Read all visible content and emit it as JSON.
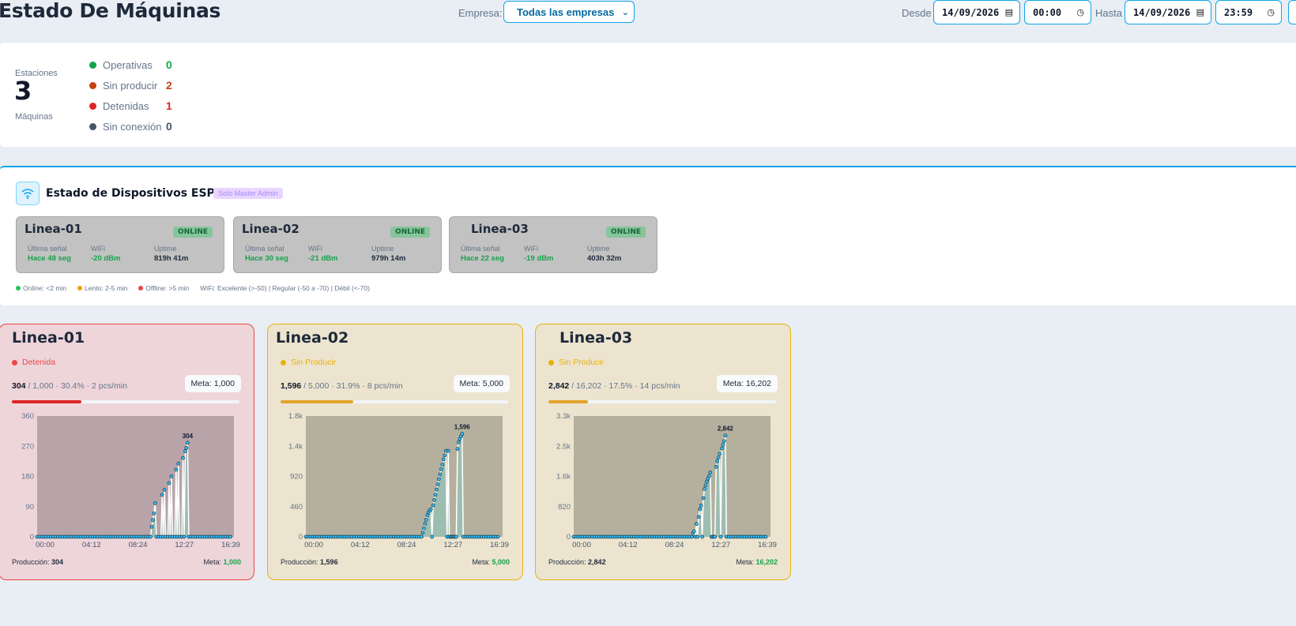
{
  "header": {
    "title": "Estado De Máquinas",
    "empresa_label": "Empresa:",
    "empresa_value": "Todas las empresas",
    "desde_label": "Desde",
    "desde_date": "14/09/2026",
    "desde_time": "00:00",
    "hasta_label": "Hasta",
    "hasta_date": "14/09/2026",
    "hasta_time": "23:59"
  },
  "summary": {
    "top_label": "Estaciones",
    "count": "3",
    "bottom_label": "Máquinas",
    "statuses": [
      {
        "label": "Operativas",
        "value": "0",
        "color": "#16a34a"
      },
      {
        "label": "Sin producir",
        "value": "2",
        "color": "#c2410c"
      },
      {
        "label": "Detenidas",
        "value": "1",
        "color": "#dc2626"
      },
      {
        "label": "Sin conexión",
        "value": "0",
        "color": "#475569"
      }
    ]
  },
  "devices": {
    "title": "Estado de Dispositivos ESP32",
    "badge": "Solo Master Admin",
    "metric_labels": {
      "signal": "Última señal",
      "wifi": "WiFi",
      "uptime": "Uptime"
    },
    "items": [
      {
        "name": "Linea-01",
        "status": "ONLINE",
        "signal": "Hace 48 seg",
        "wifi": "-20 dBm",
        "uptime": "819h 41m"
      },
      {
        "name": "Linea-02",
        "status": "ONLINE",
        "signal": "Hace 30 seg",
        "wifi": "-21 dBm",
        "uptime": "979h 14m"
      },
      {
        "name": "Linea-03",
        "status": "ONLINE",
        "signal": "Hace 22 seg",
        "wifi": "-19 dBm",
        "uptime": "403h 32m"
      }
    ],
    "legend": {
      "online": "Online: <2 min",
      "slow": "Lento: 2-5 min",
      "offline": "Offline: >5 min",
      "wifi": "WiFi: Excelente (>-50) | Regular (-50 a -70) | Débil (<-70)"
    },
    "colors": {
      "online": "#22c55e",
      "slow": "#f59e0b",
      "offline": "#ef4444",
      "ok_text": "#16a34a"
    }
  },
  "machines": [
    {
      "name": "Linea-01",
      "status": "Detenida",
      "status_color": "#ef4444",
      "produced": "304",
      "goal_text": "1,000",
      "pct": "30.4%",
      "rate": "2 pcs/min",
      "meta_label": "Meta: 1,000",
      "progress": 0.304,
      "bar_color": "#dc2626",
      "footer_prod_label": "Producción:",
      "footer_prod": "304",
      "footer_meta_label": "Meta:",
      "footer_meta": "1,000"
    },
    {
      "name": "Linea-02",
      "status": "Sin Producir",
      "status_color": "#eab308",
      "produced": "1,596",
      "goal_text": "5,000",
      "pct": "31.9%",
      "rate": "8 pcs/min",
      "meta_label": "Meta: 5,000",
      "progress": 0.319,
      "bar_color": "#e2a42c",
      "footer_prod_label": "Producción:",
      "footer_prod": "1,596",
      "footer_meta_label": "Meta:",
      "footer_meta": "5,000"
    },
    {
      "name": "Linea-03",
      "status": "Sin Producir",
      "status_color": "#eab308",
      "produced": "2,842",
      "goal_text": "16,202",
      "pct": "17.5%",
      "rate": "14 pcs/min",
      "meta_label": "Meta: 16,202",
      "progress": 0.175,
      "bar_color": "#e2a42c",
      "footer_prod_label": "Producción:",
      "footer_prod": "2,842",
      "footer_meta_label": "Meta:",
      "footer_meta": "16,202"
    }
  ],
  "chart_data": [
    {
      "type": "area",
      "x_ticks": [
        "00:00",
        "04:12",
        "08:24",
        "12:27",
        "16:39"
      ],
      "y_ticks": [
        "0",
        "90",
        "180",
        "270",
        "360"
      ],
      "ylim": [
        0,
        360
      ],
      "peak_label": "304",
      "colors": {
        "plot_bg": "#b7a3a8",
        "fill": "#9bbfb3",
        "line": "#ffffff",
        "point": "#38bdf8"
      },
      "points": [
        [
          0,
          0
        ],
        [
          4,
          0
        ],
        [
          8,
          0
        ],
        [
          12,
          0
        ],
        [
          16,
          0
        ],
        [
          20,
          0
        ],
        [
          24,
          0
        ],
        [
          28,
          0
        ],
        [
          32,
          0
        ],
        [
          36,
          0
        ],
        [
          40,
          0
        ],
        [
          44,
          0
        ],
        [
          48,
          0
        ],
        [
          52,
          0
        ],
        [
          56,
          0
        ],
        [
          60,
          0
        ],
        [
          64,
          0
        ],
        [
          68,
          0
        ],
        [
          72,
          0
        ],
        [
          76,
          0
        ],
        [
          80,
          0
        ],
        [
          84,
          0
        ],
        [
          88,
          0
        ],
        [
          92,
          0
        ],
        [
          96,
          0
        ],
        [
          100,
          0
        ],
        [
          104,
          0
        ],
        [
          108,
          0
        ],
        [
          112,
          0
        ],
        [
          116,
          0
        ],
        [
          120,
          0
        ],
        [
          124,
          0
        ],
        [
          128,
          0
        ],
        [
          132,
          0
        ],
        [
          136,
          0
        ],
        [
          140,
          0
        ],
        [
          144,
          0
        ],
        [
          148,
          0
        ],
        [
          152,
          0
        ],
        [
          156,
          0
        ],
        [
          160,
          0
        ],
        [
          164,
          0
        ],
        [
          168,
          0
        ],
        [
          172,
          0
        ],
        [
          176,
          0
        ],
        [
          180,
          0
        ],
        [
          184,
          0
        ],
        [
          188,
          0
        ],
        [
          192,
          0
        ],
        [
          196,
          0
        ],
        [
          198,
          30
        ],
        [
          200,
          50
        ],
        [
          202,
          70
        ],
        [
          204,
          100
        ],
        [
          206,
          0
        ],
        [
          210,
          0
        ],
        [
          214,
          0
        ],
        [
          216,
          125
        ],
        [
          218,
          0
        ],
        [
          220,
          140
        ],
        [
          222,
          0
        ],
        [
          226,
          0
        ],
        [
          228,
          160
        ],
        [
          230,
          0
        ],
        [
          232,
          180
        ],
        [
          234,
          0
        ],
        [
          238,
          0
        ],
        [
          240,
          200
        ],
        [
          242,
          0
        ],
        [
          244,
          218
        ],
        [
          246,
          0
        ],
        [
          250,
          0
        ],
        [
          252,
          235
        ],
        [
          254,
          0
        ],
        [
          256,
          255
        ],
        [
          258,
          265
        ],
        [
          260,
          280
        ],
        [
          262,
          0
        ],
        [
          266,
          0
        ],
        [
          270,
          0
        ],
        [
          274,
          0
        ],
        [
          278,
          0
        ],
        [
          282,
          0
        ],
        [
          286,
          0
        ],
        [
          290,
          0
        ],
        [
          294,
          0
        ],
        [
          298,
          0
        ],
        [
          302,
          0
        ],
        [
          306,
          0
        ],
        [
          310,
          0
        ],
        [
          314,
          0
        ],
        [
          318,
          0
        ],
        [
          322,
          0
        ],
        [
          326,
          0
        ],
        [
          330,
          0
        ],
        [
          334,
          0
        ]
      ]
    },
    {
      "type": "area",
      "x_ticks": [
        "00:00",
        "04:12",
        "08:24",
        "12:27",
        "16:39"
      ],
      "y_ticks": [
        "0",
        "460",
        "920",
        "1.4k",
        "1.8k"
      ],
      "ylim": [
        0,
        1840
      ],
      "peak_label": "1,596",
      "colors": {
        "plot_bg": "#b5b09e",
        "fill": "#9bbfb3",
        "line": "#ffffff",
        "point": "#38bdf8"
      },
      "points": [
        [
          0,
          0
        ],
        [
          4,
          0
        ],
        [
          8,
          0
        ],
        [
          12,
          0
        ],
        [
          16,
          0
        ],
        [
          20,
          0
        ],
        [
          24,
          0
        ],
        [
          28,
          0
        ],
        [
          32,
          0
        ],
        [
          36,
          0
        ],
        [
          40,
          0
        ],
        [
          44,
          0
        ],
        [
          48,
          0
        ],
        [
          52,
          0
        ],
        [
          56,
          0
        ],
        [
          60,
          0
        ],
        [
          64,
          0
        ],
        [
          68,
          0
        ],
        [
          72,
          0
        ],
        [
          76,
          0
        ],
        [
          80,
          0
        ],
        [
          84,
          0
        ],
        [
          88,
          0
        ],
        [
          92,
          0
        ],
        [
          96,
          0
        ],
        [
          100,
          0
        ],
        [
          104,
          0
        ],
        [
          108,
          0
        ],
        [
          112,
          0
        ],
        [
          116,
          0
        ],
        [
          120,
          0
        ],
        [
          124,
          0
        ],
        [
          128,
          0
        ],
        [
          132,
          0
        ],
        [
          136,
          0
        ],
        [
          140,
          0
        ],
        [
          144,
          0
        ],
        [
          148,
          0
        ],
        [
          152,
          0
        ],
        [
          156,
          0
        ],
        [
          160,
          0
        ],
        [
          164,
          0
        ],
        [
          168,
          0
        ],
        [
          172,
          0
        ],
        [
          176,
          0
        ],
        [
          180,
          0
        ],
        [
          184,
          0
        ],
        [
          188,
          0
        ],
        [
          192,
          0
        ],
        [
          196,
          0
        ],
        [
          200,
          0
        ],
        [
          202,
          60
        ],
        [
          204,
          130
        ],
        [
          206,
          200
        ],
        [
          208,
          260
        ],
        [
          210,
          330
        ],
        [
          212,
          370
        ],
        [
          214,
          400
        ],
        [
          216,
          420
        ],
        [
          218,
          0
        ],
        [
          220,
          480
        ],
        [
          222,
          560
        ],
        [
          224,
          640
        ],
        [
          226,
          720
        ],
        [
          228,
          800
        ],
        [
          230,
          880
        ],
        [
          232,
          950
        ],
        [
          234,
          1030
        ],
        [
          236,
          1100
        ],
        [
          238,
          1180
        ],
        [
          240,
          1240
        ],
        [
          242,
          1310
        ],
        [
          244,
          0
        ],
        [
          246,
          1310
        ],
        [
          248,
          0
        ],
        [
          250,
          0
        ],
        [
          252,
          0
        ],
        [
          254,
          0
        ],
        [
          256,
          0
        ],
        [
          258,
          0
        ],
        [
          260,
          0
        ],
        [
          262,
          1340
        ],
        [
          264,
          1440
        ],
        [
          266,
          1490
        ],
        [
          268,
          1530
        ],
        [
          270,
          1570
        ],
        [
          272,
          0
        ],
        [
          276,
          0
        ],
        [
          280,
          0
        ],
        [
          284,
          0
        ],
        [
          288,
          0
        ],
        [
          292,
          0
        ],
        [
          296,
          0
        ],
        [
          300,
          0
        ],
        [
          304,
          0
        ],
        [
          308,
          0
        ],
        [
          312,
          0
        ],
        [
          316,
          0
        ],
        [
          320,
          0
        ],
        [
          324,
          0
        ],
        [
          328,
          0
        ],
        [
          332,
          0
        ]
      ]
    },
    {
      "type": "area",
      "x_ticks": [
        "00:00",
        "04:12",
        "08:24",
        "12:27",
        "16:39"
      ],
      "y_ticks": [
        "0",
        "820",
        "1.6k",
        "2.5k",
        "3.3k"
      ],
      "ylim": [
        0,
        3280
      ],
      "peak_label": "2,842",
      "colors": {
        "plot_bg": "#b5b09e",
        "fill": "#9bbfb3",
        "line": "#ffffff",
        "point": "#38bdf8"
      },
      "points": [
        [
          0,
          0
        ],
        [
          4,
          0
        ],
        [
          8,
          0
        ],
        [
          12,
          0
        ],
        [
          16,
          0
        ],
        [
          20,
          0
        ],
        [
          24,
          0
        ],
        [
          28,
          0
        ],
        [
          32,
          0
        ],
        [
          36,
          0
        ],
        [
          40,
          0
        ],
        [
          44,
          0
        ],
        [
          48,
          0
        ],
        [
          52,
          0
        ],
        [
          56,
          0
        ],
        [
          60,
          0
        ],
        [
          64,
          0
        ],
        [
          68,
          0
        ],
        [
          72,
          0
        ],
        [
          76,
          0
        ],
        [
          80,
          0
        ],
        [
          84,
          0
        ],
        [
          88,
          0
        ],
        [
          92,
          0
        ],
        [
          96,
          0
        ],
        [
          100,
          0
        ],
        [
          104,
          0
        ],
        [
          108,
          0
        ],
        [
          112,
          0
        ],
        [
          116,
          0
        ],
        [
          120,
          0
        ],
        [
          124,
          0
        ],
        [
          128,
          0
        ],
        [
          132,
          0
        ],
        [
          136,
          0
        ],
        [
          140,
          0
        ],
        [
          144,
          0
        ],
        [
          148,
          0
        ],
        [
          152,
          0
        ],
        [
          156,
          0
        ],
        [
          160,
          0
        ],
        [
          164,
          0
        ],
        [
          168,
          0
        ],
        [
          172,
          0
        ],
        [
          176,
          0
        ],
        [
          180,
          0
        ],
        [
          184,
          0
        ],
        [
          188,
          0
        ],
        [
          192,
          0
        ],
        [
          196,
          0
        ],
        [
          200,
          0
        ],
        [
          204,
          0
        ],
        [
          206,
          100
        ],
        [
          208,
          150
        ],
        [
          210,
          0
        ],
        [
          212,
          350
        ],
        [
          214,
          0
        ],
        [
          216,
          540
        ],
        [
          218,
          750
        ],
        [
          220,
          850
        ],
        [
          222,
          0
        ],
        [
          224,
          1050
        ],
        [
          226,
          1300
        ],
        [
          228,
          1400
        ],
        [
          230,
          1500
        ],
        [
          232,
          1580
        ],
        [
          234,
          1650
        ],
        [
          236,
          1750
        ],
        [
          238,
          0
        ],
        [
          240,
          0
        ],
        [
          242,
          0
        ],
        [
          244,
          0
        ],
        [
          246,
          1900
        ],
        [
          248,
          2050
        ],
        [
          250,
          2150
        ],
        [
          252,
          2250
        ],
        [
          254,
          0
        ],
        [
          256,
          2400
        ],
        [
          258,
          2500
        ],
        [
          260,
          2600
        ],
        [
          262,
          2750
        ],
        [
          264,
          0
        ],
        [
          268,
          0
        ],
        [
          272,
          0
        ],
        [
          276,
          0
        ],
        [
          280,
          0
        ],
        [
          284,
          0
        ],
        [
          288,
          0
        ],
        [
          292,
          0
        ],
        [
          296,
          0
        ],
        [
          300,
          0
        ],
        [
          304,
          0
        ],
        [
          308,
          0
        ],
        [
          312,
          0
        ],
        [
          316,
          0
        ],
        [
          320,
          0
        ],
        [
          324,
          0
        ],
        [
          328,
          0
        ],
        [
          332,
          0
        ]
      ]
    }
  ]
}
